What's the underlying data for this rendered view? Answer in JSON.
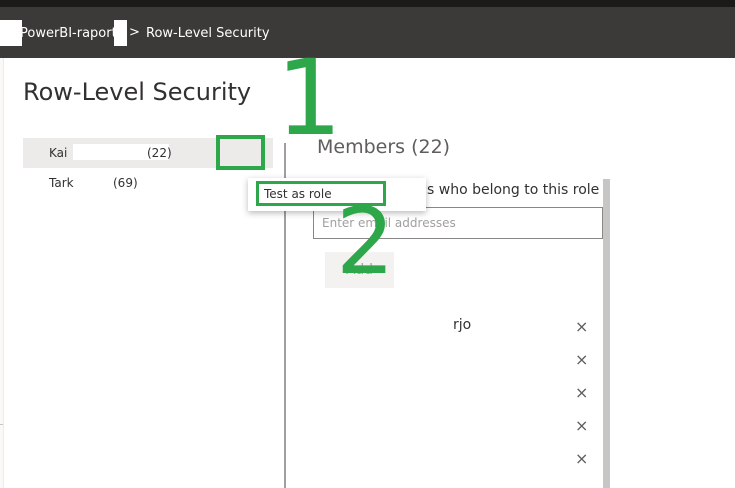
{
  "breadcrumb": {
    "workspace": "PowerBI-raport",
    "separator": ">",
    "current": "Row-Level Security"
  },
  "page": {
    "title": "Row-Level Security"
  },
  "roles": [
    {
      "name": "Kai",
      "count": "(22)",
      "selected": true
    },
    {
      "name": "Tark",
      "count": "(69)",
      "selected": false
    }
  ],
  "context_menu": {
    "test_as_role": "Test as role"
  },
  "members": {
    "title": "Members (22)",
    "description": "s who belong to this role",
    "email_placeholder": "Enter email addresses",
    "add_label": "Add",
    "items": [
      {
        "name": "rjo"
      }
    ],
    "remove_symbol": "×"
  },
  "annotations": {
    "step_1": "1",
    "step_2": "2",
    "color": "#2ea64a"
  },
  "colors": {
    "header_bg": "#3b3a39",
    "selected_row_bg": "#edebe9",
    "annotation_green": "#2ea64a"
  },
  "icons": {
    "remove": "close-icon",
    "more_options": "more-options-icon"
  }
}
